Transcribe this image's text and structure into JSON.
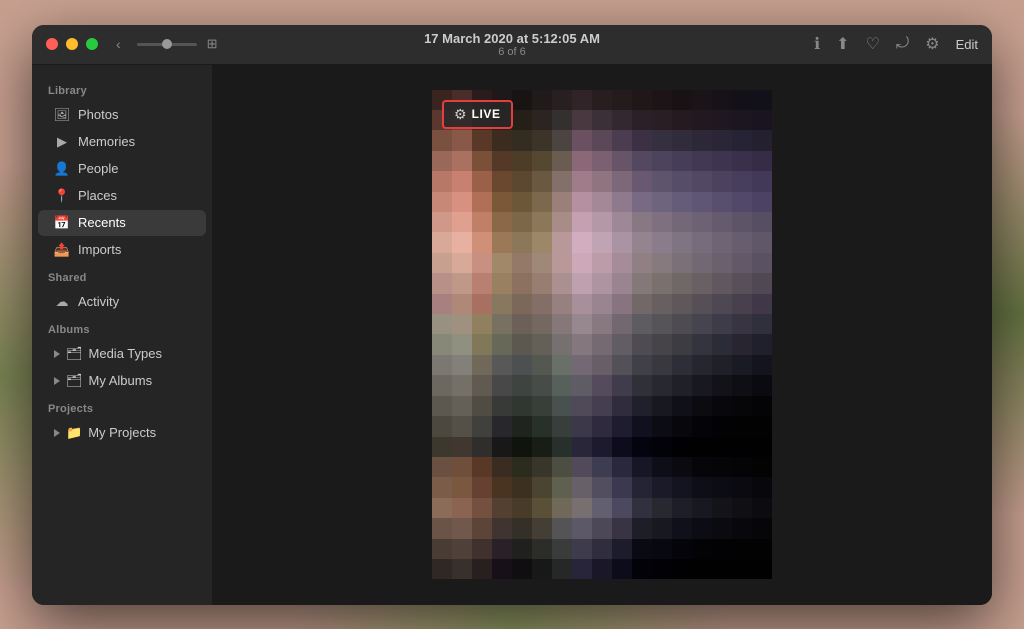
{
  "window": {
    "title": "17 March 2020 at 5:12:05 AM",
    "subtitle": "6 of 6"
  },
  "controls": {
    "close": "close",
    "minimize": "minimize",
    "maximize": "maximize"
  },
  "nav": {
    "back": "‹",
    "forward": "›"
  },
  "toolbar": {
    "info_icon": "ℹ",
    "share_icon": "⬆",
    "heart_icon": "♡",
    "rotate_icon": "⤾",
    "adjust_icon": "⚙",
    "edit_label": "Edit"
  },
  "sidebar": {
    "library_label": "Library",
    "items_library": [
      {
        "id": "photos",
        "label": "Photos",
        "icon": "🖼"
      },
      {
        "id": "memories",
        "label": "Memories",
        "icon": "▶"
      },
      {
        "id": "people",
        "label": "People",
        "icon": "👤"
      },
      {
        "id": "places",
        "label": "Places",
        "icon": "📍"
      },
      {
        "id": "recents",
        "label": "Recents",
        "icon": "📅",
        "active": true
      },
      {
        "id": "imports",
        "label": "Imports",
        "icon": "📤"
      }
    ],
    "shared_label": "Shared",
    "items_shared": [
      {
        "id": "activity",
        "label": "Activity",
        "icon": "☁"
      }
    ],
    "albums_label": "Albums",
    "items_albums": [
      {
        "id": "media-types",
        "label": "Media Types",
        "expandable": true
      },
      {
        "id": "my-albums",
        "label": "My Albums",
        "expandable": true
      }
    ],
    "projects_label": "Projects",
    "items_projects": [
      {
        "id": "my-projects",
        "label": "My Projects",
        "expandable": true
      }
    ]
  },
  "live_badge": {
    "label": "LIVE"
  },
  "mosaic_colors": [
    "#3a2420",
    "#4a2c28",
    "#2a1c18",
    "#1e1818",
    "#181414",
    "#201a1a",
    "#282020",
    "#302428",
    "#281e20",
    "#241c1c",
    "#201818",
    "#1c1416",
    "#181214",
    "#1a1418",
    "#161218",
    "#141018",
    "#121018",
    "#5a3830",
    "#6a4038",
    "#3a2820",
    "#2a2018",
    "#242018",
    "#2c2420",
    "#343030",
    "#4a3840",
    "#3c3038",
    "#342830",
    "#2c2028",
    "#281e24",
    "#241a20",
    "#221820",
    "#201820",
    "#1c1620",
    "#1a1420",
    "#7a5040",
    "#8a5848",
    "#5a3828",
    "#3c2c20",
    "#342c20",
    "#3c3428",
    "#4c4440",
    "#6a5060",
    "#5a4858",
    "#4c3c50",
    "#3c3044",
    "#343040",
    "#302c3c",
    "#2c2838",
    "#2a2638",
    "#262434",
    "#242030",
    "#9a6858",
    "#aa7060",
    "#7a5038",
    "#543828",
    "#4c3c28",
    "#544830",
    "#6a5c50",
    "#8a6878",
    "#7a6070",
    "#685468",
    "#544860",
    "#4c445c",
    "#463e58",
    "#423854",
    "#3e3450",
    "#3a304c",
    "#362c48",
    "#b87868",
    "#c88070",
    "#9a6048",
    "#6a4830",
    "#5c4830",
    "#6a5840",
    "#84706a",
    "#a07c8a",
    "#907480",
    "#7c6878",
    "#685870",
    "#5e546c",
    "#564e68",
    "#524864",
    "#4c4260",
    "#463e5c",
    "#423858",
    "#c88878",
    "#d89080",
    "#b07058",
    "#7a5838",
    "#6c5838",
    "#7c684c",
    "#9a8078",
    "#b490a0",
    "#a48898",
    "#8e7a8c",
    "#786a84",
    "#6e647e",
    "#645c78",
    "#5e5674",
    "#584e6e",
    "#52486a",
    "#4c4264",
    "#d09888",
    "#e0a090",
    "#c08068",
    "#8a6848",
    "#7c6848",
    "#8c7858",
    "#a88c88",
    "#c4a0b0",
    "#b498a8",
    "#9e8898",
    "#887884",
    "#7e7080",
    "#746878",
    "#6c6274",
    "#645c6e",
    "#5e5468",
    "#564e62",
    "#d8a898",
    "#e8b0a0",
    "#d09078",
    "#9a7858",
    "#8c7858",
    "#9c8868",
    "#b89898",
    "#d0aec0",
    "#c0a4b4",
    "#aa94a4",
    "#948490",
    "#8a7c8a",
    "#7e7482",
    "#766c7c",
    "#6e6474",
    "#665e6e",
    "#605868",
    "#c8a090",
    "#d8a898",
    "#c89080",
    "#a08868",
    "#947868",
    "#a08878",
    "#b89898",
    "#cca8b8",
    "#bc9ca8",
    "#a68c98",
    "#908084",
    "#867a7e",
    "#7c7078",
    "#726874",
    "#6a606e",
    "#625868",
    "#5a5262",
    "#b89088",
    "#c09888",
    "#b88070",
    "#988060",
    "#8c7060",
    "#987e70",
    "#aa9090",
    "#bea0ae",
    "#ae94a0",
    "#9a8490",
    "#847878",
    "#7a706c",
    "#706866",
    "#686062",
    "#60585e",
    "#585058",
    "#504852",
    "#a88080",
    "#b08878",
    "#a87060",
    "#887860",
    "#7c6858",
    "#846e68",
    "#968080",
    "#a8909a",
    "#9a8490",
    "#887480",
    "#726868",
    "#686060",
    "#5e585a",
    "#565056",
    "#4e4852",
    "#48404c",
    "#403848",
    "#989080",
    "#a09080",
    "#908060",
    "#787060",
    "#6c6058",
    "#746860",
    "#867878",
    "#96888e",
    "#887880",
    "#746870",
    "#5e5c60",
    "#565458",
    "#4e4c52",
    "#46444e",
    "#3e3c48",
    "#383442",
    "#30303c",
    "#888878",
    "#909080",
    "#807858",
    "#686858",
    "#5c5850",
    "#646058",
    "#767070",
    "#84787e",
    "#766a72",
    "#625c64",
    "#4e4c52",
    "#464448",
    "#3c3c42",
    "#34343e",
    "#2c2c38",
    "#282430",
    "#20202c",
    "#7a7870",
    "#828078",
    "#706858",
    "#585858",
    "#4c5050",
    "#545850",
    "#687068",
    "#746874",
    "#685e68",
    "#545058",
    "#404048",
    "#38383e",
    "#2e2e38",
    "#262630",
    "#202028",
    "#1a1a24",
    "#14141e",
    "#6c6860",
    "#747068",
    "#605a50",
    "#484848",
    "#404440",
    "#484c48",
    "#58605c",
    "#605c66",
    "#544c5c",
    "#403c4c",
    "#303038",
    "#282830",
    "#202028",
    "#181820",
    "#121218",
    "#0e0e14",
    "#0a0a10",
    "#5c5850",
    "#646058",
    "#504c44",
    "#383a38",
    "#303630",
    "#383e38",
    "#485050",
    "#504a58",
    "#443e50",
    "#302c3e",
    "#20202c",
    "#181820",
    "#101018",
    "#0c0c10",
    "#08080c",
    "#060608",
    "#040406",
    "#4c4840",
    "#545048",
    "#40403c",
    "#28282c",
    "#20241e",
    "#28302a",
    "#383e3c",
    "#3c384a",
    "#302a3e",
    "#1e1c2e",
    "#10101e",
    "#0c0c14",
    "#08080c",
    "#040408",
    "#020204",
    "#020202",
    "#020202",
    "#3c382e",
    "#403830",
    "#302e2c",
    "#181818",
    "#10140c",
    "#181e16",
    "#28302c",
    "#282638",
    "#1c1a2c",
    "#0e0c1c",
    "#04040e",
    "#020208",
    "#010104",
    "#010102",
    "#010102",
    "#010101",
    "#010101",
    "#6a5040",
    "#704e3c",
    "#5a3828",
    "#3a2c20",
    "#2c2c1e",
    "#38362a",
    "#4c4e42",
    "#504a5a",
    "#3e3c50",
    "#2a283c",
    "#161626",
    "#0e0e18",
    "#0a0a10",
    "#06060a",
    "#050508",
    "#040406",
    "#030304",
    "#7a5c48",
    "#7a5840",
    "#664030",
    "#483420",
    "#3c3020",
    "#4a4430",
    "#606050",
    "#686068",
    "#524e60",
    "#3c3850",
    "#242434",
    "#1a1a28",
    "#141420",
    "#0e0e18",
    "#0c0c14",
    "#0a0a10",
    "#08080c",
    "#8a6c58",
    "#8a6450",
    "#745040",
    "#544030",
    "#483c28",
    "#5a5038",
    "#706858",
    "#787070",
    "#626070",
    "#4c4860",
    "#30303e",
    "#282830",
    "#1e1e28",
    "#181820",
    "#141418",
    "#101014",
    "#0c0c10",
    "#6a5448",
    "#70584c",
    "#5c4438",
    "#403430",
    "#343028",
    "#443e34",
    "#545456",
    "#5c5868",
    "#4c4858",
    "#383444",
    "#1e1e28",
    "#181820",
    "#10101a",
    "#0c0c14",
    "#0a0a10",
    "#08080c",
    "#060608",
    "#483c34",
    "#50403a",
    "#40302e",
    "#2a2028",
    "#20201e",
    "#2c2c28",
    "#3a3c3c",
    "#3e3c4c",
    "#302e3e",
    "#1c1c2c",
    "#0a0a14",
    "#080810",
    "#04040a",
    "#030306",
    "#020204",
    "#020202",
    "#020202",
    "#302824",
    "#38302a",
    "#28201e",
    "#181018",
    "#100e10",
    "#181818",
    "#262828",
    "#28243a",
    "#1a1828",
    "#0c0c1a",
    "#020208",
    "#020206",
    "#010104",
    "#010102",
    "#010101",
    "#010101",
    "#010101"
  ]
}
